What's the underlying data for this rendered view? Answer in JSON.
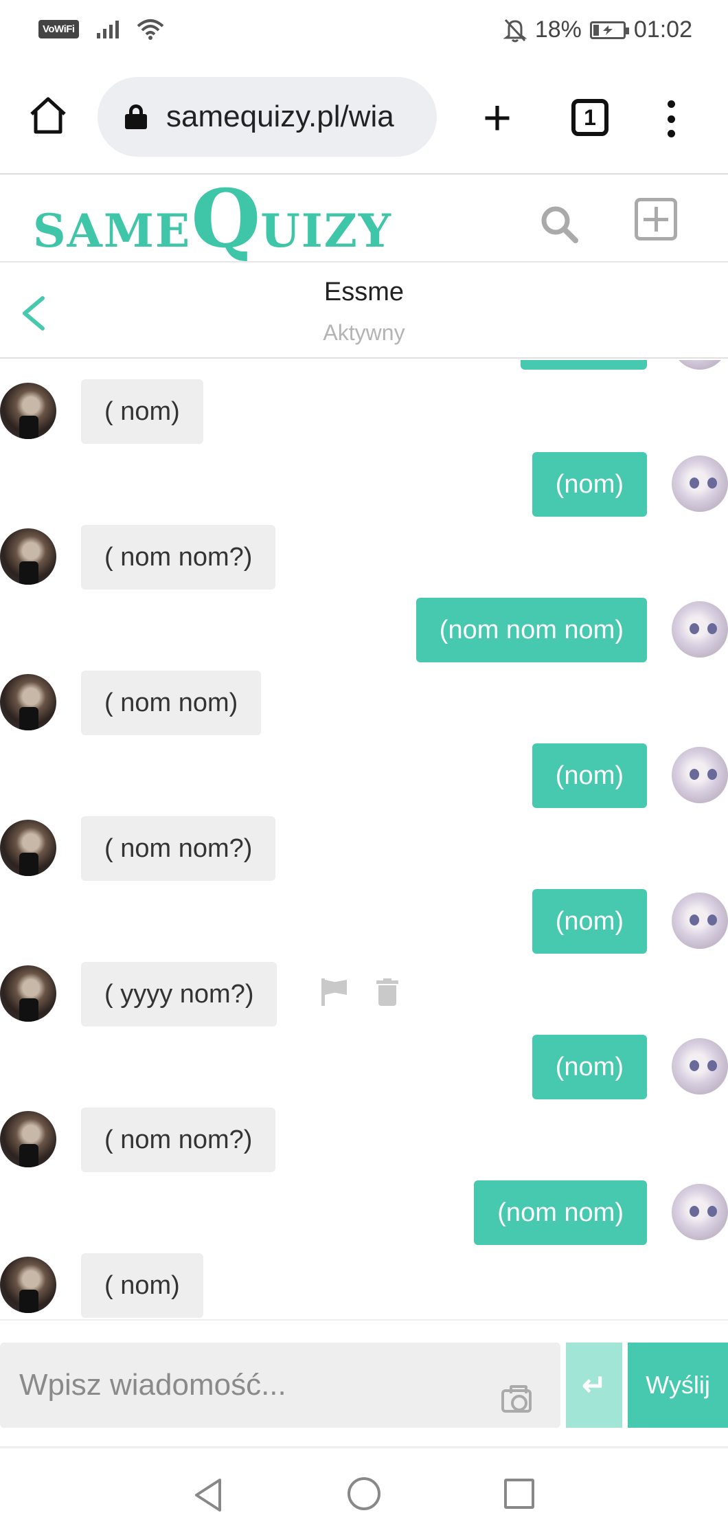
{
  "status_bar": {
    "vowifi": "VoWiFi",
    "battery": "18%",
    "time": "01:02"
  },
  "browser": {
    "url": "samequizy.pl/wia",
    "tab_count": "1"
  },
  "site": {
    "logo_prefix": "SAME",
    "logo_big_letter": "Q",
    "logo_suffix": "UIZY",
    "brand_color": "#46c9ae"
  },
  "conversation": {
    "name": "Essme",
    "status": "Aktywny"
  },
  "messages": [
    {
      "from": "them",
      "text": "( nom)"
    },
    {
      "from": "me",
      "text": "(nom)"
    },
    {
      "from": "them",
      "text": "( nom nom?)"
    },
    {
      "from": "me",
      "text": "(nom nom nom)"
    },
    {
      "from": "them",
      "text": "( nom nom)"
    },
    {
      "from": "me",
      "text": "(nom)"
    },
    {
      "from": "them",
      "text": "( nom nom?)"
    },
    {
      "from": "me",
      "text": "(nom)"
    },
    {
      "from": "them",
      "text": "( yyyy nom?)"
    },
    {
      "from": "me",
      "text": "(nom)"
    },
    {
      "from": "them",
      "text": "( nom nom?)"
    },
    {
      "from": "me",
      "text": "(nom nom)"
    },
    {
      "from": "them",
      "text": "( nom)"
    }
  ],
  "composer": {
    "placeholder": "Wpisz wiadomość...",
    "send_label": "Wyślij",
    "enter_symbol": "↵"
  }
}
